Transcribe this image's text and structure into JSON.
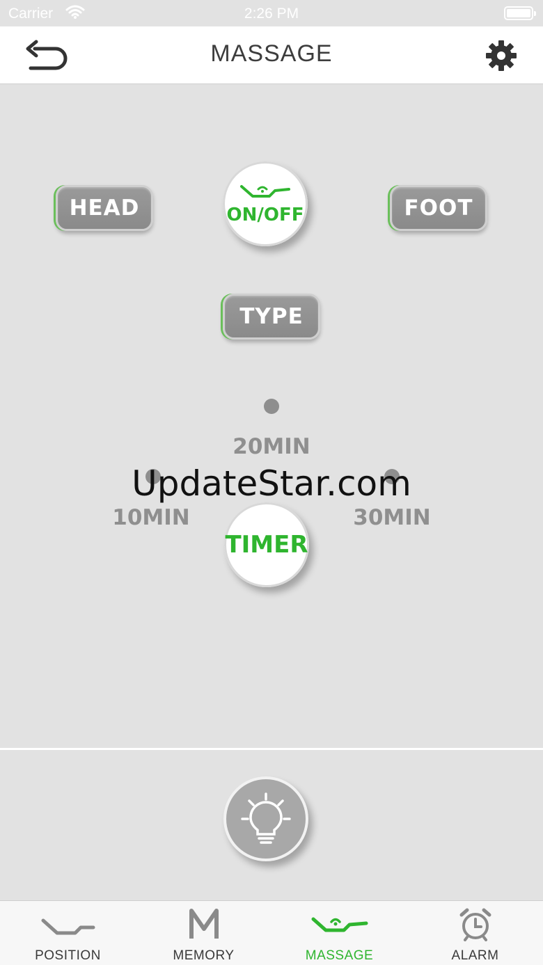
{
  "status_bar": {
    "carrier": "Carrier",
    "time": "2:26 PM"
  },
  "header": {
    "title": "MASSAGE",
    "back_icon": "back-arrow-icon",
    "settings_icon": "gear-icon"
  },
  "controls": {
    "head_label": "HEAD",
    "onoff_label": "ON/OFF",
    "foot_label": "FOOT",
    "type_label": "TYPE"
  },
  "timer": {
    "button_label": "TIMER",
    "options": [
      "10MIN",
      "20MIN",
      "30MIN"
    ]
  },
  "watermark": "UpdateStar.com",
  "light_icon": "lightbulb-icon",
  "tabs": [
    {
      "label": "POSITION",
      "icon": "bed-position-icon",
      "active": false
    },
    {
      "label": "MEMORY",
      "icon": "memory-m-icon",
      "active": false
    },
    {
      "label": "MASSAGE",
      "icon": "massage-icon",
      "active": true
    },
    {
      "label": "ALARM",
      "icon": "alarm-clock-icon",
      "active": false
    }
  ],
  "colors": {
    "accent_green": "#2fb52f",
    "background": "#e2e2e2",
    "button_gray": "#919191"
  }
}
